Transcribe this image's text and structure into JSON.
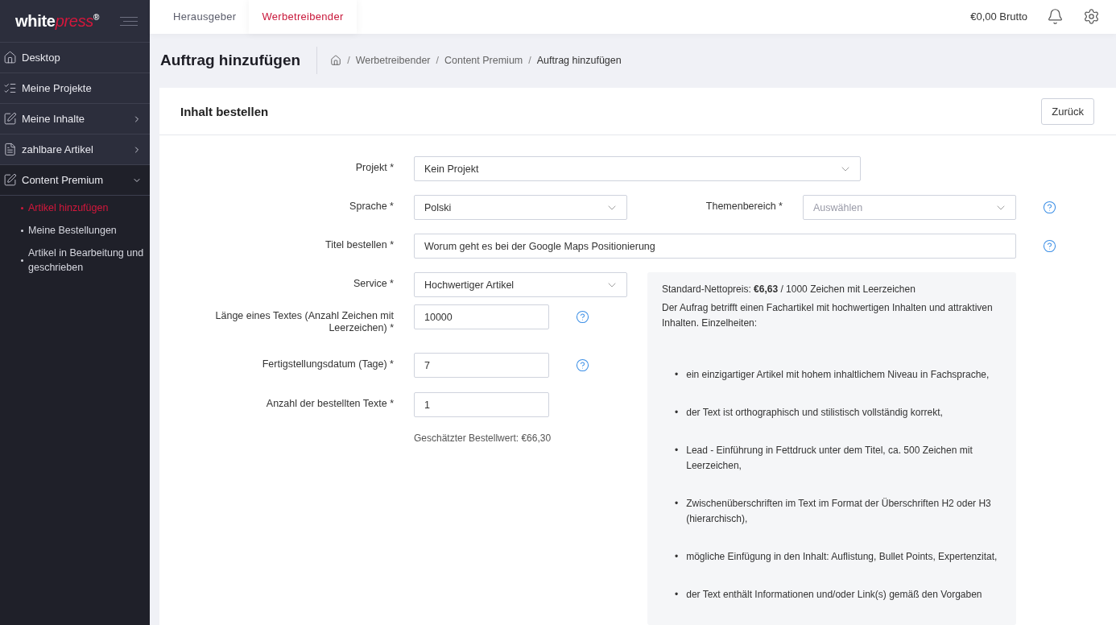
{
  "logo": {
    "text_main": "white",
    "text_accent": "press",
    "mark": "®"
  },
  "sidebar": {
    "items": [
      {
        "label": "Desktop",
        "kind": "link"
      },
      {
        "label": "Meine Projekte",
        "kind": "link"
      },
      {
        "label": "Meine Inhalte",
        "kind": "group",
        "expanded": false
      },
      {
        "label": "zahlbare Artikel",
        "kind": "group",
        "expanded": false
      },
      {
        "label": "Content Premium",
        "kind": "group",
        "expanded": true,
        "children": [
          {
            "label": "Artikel hinzufügen",
            "selected": true
          },
          {
            "label": "Meine Bestellungen",
            "selected": false
          },
          {
            "label": "Artikel in Bearbeitung und geschrieben",
            "selected": false
          }
        ]
      }
    ]
  },
  "top_tabs": [
    {
      "label": "Herausgeber",
      "selected": false
    },
    {
      "label": "Werbetreibender",
      "selected": true
    }
  ],
  "balance": "€0,00 Brutto",
  "page_title": "Auftrag hinzufügen",
  "breadcrumb": [
    {
      "separator": "/",
      "label": "Werbetreibender"
    },
    {
      "separator": "/",
      "label": "Content Premium"
    },
    {
      "separator": "/",
      "label": "Auftrag hinzufügen"
    }
  ],
  "card": {
    "title": "Inhalt bestellen",
    "back_button": "Zurück"
  },
  "form": {
    "project": {
      "label": "Projekt *",
      "value": "Kein Projekt"
    },
    "language": {
      "label": "Sprache *",
      "value": "Polski"
    },
    "topic": {
      "label": "Themenbereich *",
      "placeholder": "Auswählen",
      "help": true
    },
    "title": {
      "label": "Titel bestellen *",
      "value": "Worum geht es bei der Google Maps Positionierung",
      "help": true
    },
    "fields": [
      {
        "kind": "select",
        "label": "Service *",
        "value": "Hochwertiger Artikel",
        "help": false
      },
      {
        "kind": "input",
        "label": "Länge eines Textes (Anzahl Zeichen mit Leerzeichen) *",
        "value": "10000",
        "help": true
      },
      {
        "kind": "input",
        "label": "Fertigstellungsdatum (Tage) *",
        "value": "7",
        "help": true
      },
      {
        "kind": "input",
        "label": "Anzahl der bestellten Texte *",
        "value": "1",
        "help": false
      }
    ],
    "estimate": "Geschätzter Bestellwert: €66,30"
  },
  "info": {
    "price": "Standard-Nettopreis: **€6,63** / 1000 Zeichen mit Leerzeichen",
    "intro": "Der Aufrag betrifft einen Fachartikel mit hochwertigen Inhalten und attraktiven Inhalten. Einzelheiten:",
    "bullets": [
      {
        "marker": "•",
        "text": "ein einzigartiger Artikel mit hohem inhaltlichem Niveau in Fachsprache,"
      },
      {
        "marker": "•",
        "text": "der Text ist orthographisch und stilistisch vollständig korrekt,"
      },
      {
        "marker": "•",
        "text": "Lead - Einführung in Fettdruck unter dem Titel, ca. 500 Zeichen mit Leerzeichen,"
      },
      {
        "marker": "•",
        "text": "Zwischenüberschriften im Text im Format der Überschriften H2 oder H3 (hierarchisch),"
      },
      {
        "marker": "•",
        "text": "mögliche Einfügung in den Inhalt: Auflistung, Bullet Points, Expertenzitat,"
      },
      {
        "marker": "•",
        "text": "der Text enthält Informationen und/oder Link(s) gemäß den Vorgaben"
      }
    ]
  }
}
